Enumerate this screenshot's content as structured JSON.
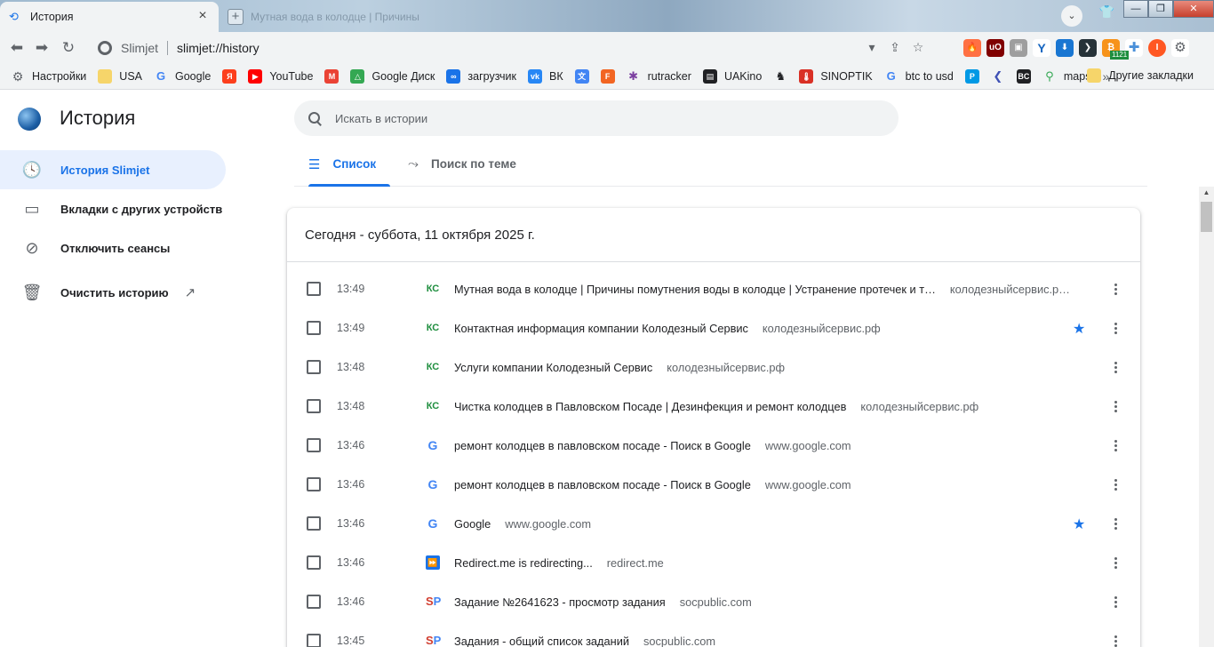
{
  "browser": {
    "tab_title": "История",
    "tab_close": "×",
    "bg_tab_title": "Мутная вода в колодце | Причины",
    "omnibox_brand": "Slimjet",
    "omnibox_url": "slimjet://history",
    "win_minimize": "—",
    "win_maximize": "❐",
    "win_close": "✕"
  },
  "bookmarks": {
    "items": [
      {
        "label": "Настройки",
        "icon": "gear-icon",
        "color": "#5f6368"
      },
      {
        "label": "USA",
        "icon": "folder-icon",
        "color": "#f6d56a"
      },
      {
        "label": "Google",
        "icon": "google-icon",
        "color": "#4285f4"
      },
      {
        "label": "",
        "icon": "yandex-icon",
        "color": "#fc3f1d"
      },
      {
        "label": "YouTube",
        "icon": "youtube-icon",
        "color": "#ff0000"
      },
      {
        "label": "",
        "icon": "gmail-icon",
        "color": "#ea4335"
      },
      {
        "label": "Google Диск",
        "icon": "drive-icon",
        "color": "#34a853"
      },
      {
        "label": "загрузчик",
        "icon": "infinity-icon",
        "color": "#1a73e8"
      },
      {
        "label": "ВК",
        "icon": "vk-icon",
        "color": "#2787f5"
      },
      {
        "label": "",
        "icon": "translate-icon",
        "color": "#4285f4"
      },
      {
        "label": "",
        "icon": "f-icon",
        "color": "#f26522"
      },
      {
        "label": "rutracker",
        "icon": "star-color-icon",
        "color": "#7b3fa0"
      },
      {
        "label": "UAKino",
        "icon": "film-icon",
        "color": "#202124"
      },
      {
        "label": "",
        "icon": "chess-icon",
        "color": "#202124"
      },
      {
        "label": "SINOPTIK",
        "icon": "thermometer-icon",
        "color": "#d93025"
      },
      {
        "label": "btc to usd",
        "icon": "google-icon",
        "color": "#4285f4"
      },
      {
        "label": "",
        "icon": "p-icon",
        "color": "#0099e5"
      },
      {
        "label": "",
        "icon": "chevron-left-icon",
        "color": "#3f51b5"
      },
      {
        "label": "",
        "icon": "bc-icon",
        "color": "#202124"
      },
      {
        "label": "maps",
        "icon": "maps-pin-icon",
        "color": "#34a853"
      }
    ],
    "more": "»",
    "other_label": "Другие закладки"
  },
  "sidebar": {
    "title": "История",
    "items": [
      {
        "label": "История Slimjet",
        "icon": "clock-icon",
        "glyph": "🕓"
      },
      {
        "label": "Вкладки с других устройств",
        "icon": "devices-icon",
        "glyph": "▭"
      },
      {
        "label": "Отключить сеансы",
        "icon": "sync-off-icon",
        "glyph": "⊘"
      },
      {
        "label": "Очистить историю",
        "icon": "trash-icon",
        "glyph": "🗑"
      }
    ],
    "external_link_glyph": "↗"
  },
  "search": {
    "placeholder": "Искать в истории"
  },
  "view_tabs": [
    {
      "label": "Список",
      "glyph": "☰"
    },
    {
      "label": "Поиск по теме",
      "glyph": "⤳"
    }
  ],
  "history": {
    "header": "Сегодня - суббота, 11 октября 2025 г.",
    "rows": [
      {
        "time": "13:49",
        "fav": "ks",
        "fav_text": "КС",
        "title": "Мутная вода в колодце | Причины помутнения воды в колодце | Устранение протечек и т…",
        "domain": "колодезныйсервис.р…",
        "starred": false
      },
      {
        "time": "13:49",
        "fav": "ks",
        "fav_text": "КС",
        "title": "Контактная информация компании Колодезный Сервис",
        "domain": "колодезныйсервис.рф",
        "starred": true
      },
      {
        "time": "13:48",
        "fav": "ks",
        "fav_text": "КС",
        "title": "Услуги компании Колодезный Сервис",
        "domain": "колодезныйсервис.рф",
        "starred": false
      },
      {
        "time": "13:48",
        "fav": "ks",
        "fav_text": "КС",
        "title": "Чистка колодцев в Павловском Посаде | Дезинфекция и ремонт колодцев",
        "domain": "колодезныйсервис.рф",
        "starred": false
      },
      {
        "time": "13:46",
        "fav": "g",
        "fav_text": "G",
        "title": "ремонт колодцев в павловском посаде - Поиск в Google",
        "domain": "www.google.com",
        "starred": false
      },
      {
        "time": "13:46",
        "fav": "g",
        "fav_text": "G",
        "title": "ремонт колодцев в павловском посаде - Поиск в Google",
        "domain": "www.google.com",
        "starred": false
      },
      {
        "time": "13:46",
        "fav": "g",
        "fav_text": "G",
        "title": "Google",
        "domain": "www.google.com",
        "starred": true
      },
      {
        "time": "13:46",
        "fav": "rd",
        "fav_text": "⏩",
        "title": "Redirect.me is redirecting...",
        "domain": "redirect.me",
        "starred": false
      },
      {
        "time": "13:46",
        "fav": "sp",
        "fav_text": "SP",
        "title": "Задание №2641623 - просмотр задания",
        "domain": "socpublic.com",
        "starred": false
      },
      {
        "time": "13:45",
        "fav": "sp",
        "fav_text": "SP",
        "title": "Задания - общий список заданий",
        "domain": "socpublic.com",
        "starred": false
      }
    ]
  },
  "colors": {
    "accent": "#1a73e8",
    "sidebar_active_bg": "#e8f0fe"
  }
}
